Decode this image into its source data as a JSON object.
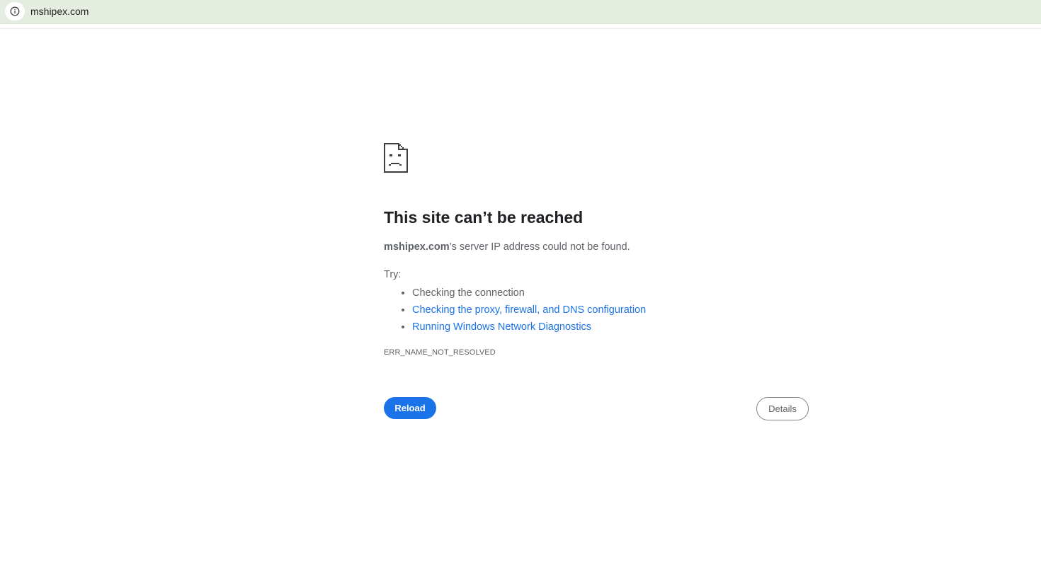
{
  "omnibox": {
    "icon": "info-circle-icon",
    "url": "mshipex.com"
  },
  "error": {
    "icon": "sad-document-icon",
    "title": "This site can’t be reached",
    "host": "mshipex.com",
    "description_suffix": "’s server IP address could not be found.",
    "try_label": "Try:",
    "suggestions": [
      {
        "text": "Checking the connection",
        "is_link": false
      },
      {
        "text": "Checking the proxy, firewall, and DNS configuration",
        "is_link": true
      },
      {
        "text": "Running Windows Network Diagnostics",
        "is_link": true
      }
    ],
    "code": "ERR_NAME_NOT_RESOLVED"
  },
  "buttons": {
    "reload": "Reload",
    "details": "Details"
  },
  "colors": {
    "omnibox_bg": "#e4ede0",
    "title": "#202124",
    "body_text": "#5f6368",
    "link": "#1a73e8",
    "primary_button": "#1a73e8"
  }
}
